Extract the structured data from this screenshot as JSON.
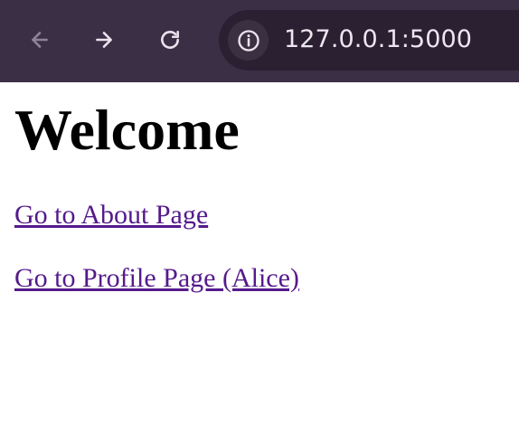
{
  "browser": {
    "url": "127.0.0.1:5000",
    "icons": {
      "back": "arrow-left-icon",
      "forward": "arrow-right-icon",
      "reload": "reload-icon",
      "site_info": "info-icon"
    },
    "colors": {
      "toolbar": "#3b2f45",
      "address_bar": "#2a2032",
      "site_info_button": "#3a3042"
    }
  },
  "page": {
    "title": "Welcome",
    "links": [
      {
        "label": "Go to About Page"
      },
      {
        "label": "Go to Profile Page (Alice)"
      }
    ],
    "colors": {
      "visited_link": "#551a8b"
    }
  }
}
